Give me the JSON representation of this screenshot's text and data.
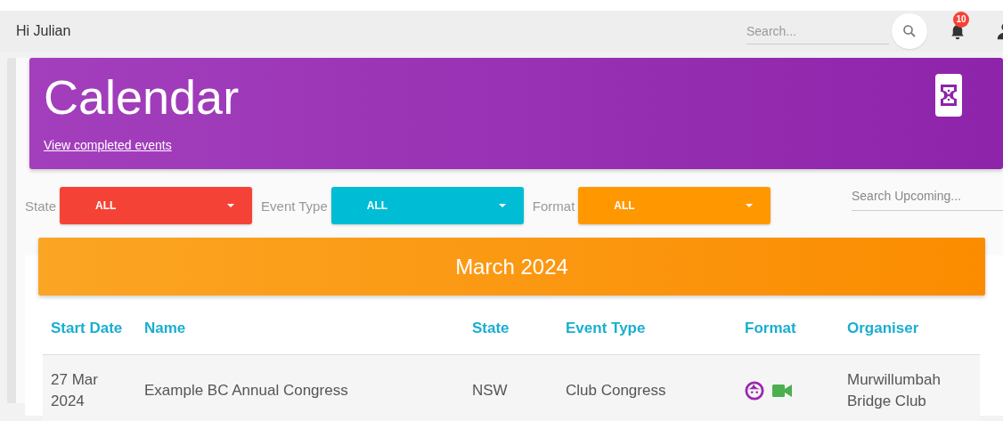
{
  "topbar": {
    "greeting": "Hi Julian",
    "search": {
      "placeholder": "Search..."
    },
    "notifications": {
      "count": "10"
    }
  },
  "header": {
    "title": "Calendar",
    "link": "View completed events"
  },
  "filters": [
    {
      "label": "State",
      "value": "ALL",
      "color": "#f44336"
    },
    {
      "label": "Event Type",
      "value": "ALL",
      "color": "#00bcd4"
    },
    {
      "label": "Format",
      "value": "ALL",
      "color": "#ff9800"
    }
  ],
  "upcoming_search": {
    "placeholder": "Search Upcoming..."
  },
  "month": "March 2024",
  "table": {
    "columns": [
      "Start Date",
      "Name",
      "State",
      "Event Type",
      "Format",
      "Organiser"
    ],
    "rows": [
      {
        "start_date": "27 Mar 2024",
        "name": "Example BC Annual Congress",
        "state": "NSW",
        "event_type": "Club Congress",
        "format": [
          {
            "kind": "face"
          },
          {
            "kind": "video"
          }
        ],
        "organiser": "Murwillumbah Bridge Club"
      }
    ]
  }
}
